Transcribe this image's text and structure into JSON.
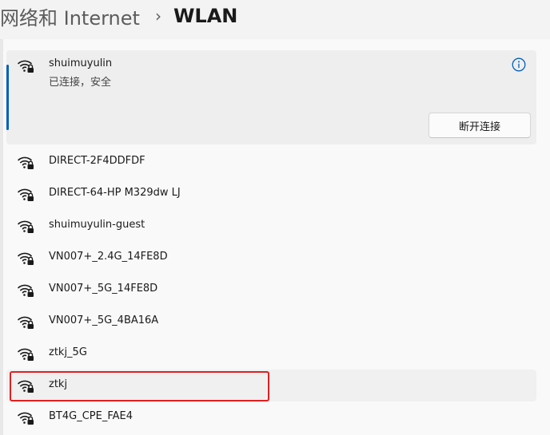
{
  "breadcrumb": {
    "parent": "网络和 Internet",
    "separator": "›",
    "current": "WLAN"
  },
  "connected": {
    "ssid": "shuimuyulin",
    "status": "已连接，安全",
    "icon": "wifi-locked-icon",
    "info_icon": "info-icon",
    "disconnect_label": "断开连接",
    "accent_color": "#005fb8"
  },
  "networks": [
    {
      "ssid": "DIRECT-2F4DDFDF",
      "icon": "wifi-locked-icon"
    },
    {
      "ssid": "DIRECT-64-HP M329dw LJ",
      "icon": "wifi-locked-icon"
    },
    {
      "ssid": "shuimuyulin-guest",
      "icon": "wifi-locked-icon"
    },
    {
      "ssid": "VN007+_2.4G_14FE8D",
      "icon": "wifi-locked-icon"
    },
    {
      "ssid": "VN007+_5G_14FE8D",
      "icon": "wifi-locked-icon"
    },
    {
      "ssid": "VN007+_5G_4BA16A",
      "icon": "wifi-locked-icon"
    },
    {
      "ssid": "ztkj_5G",
      "icon": "wifi-locked-icon"
    },
    {
      "ssid": "ztkj",
      "icon": "wifi-locked-icon"
    },
    {
      "ssid": "BT4G_CPE_FAE4",
      "icon": "wifi-locked-icon"
    }
  ],
  "highlight_color": "#e02020"
}
